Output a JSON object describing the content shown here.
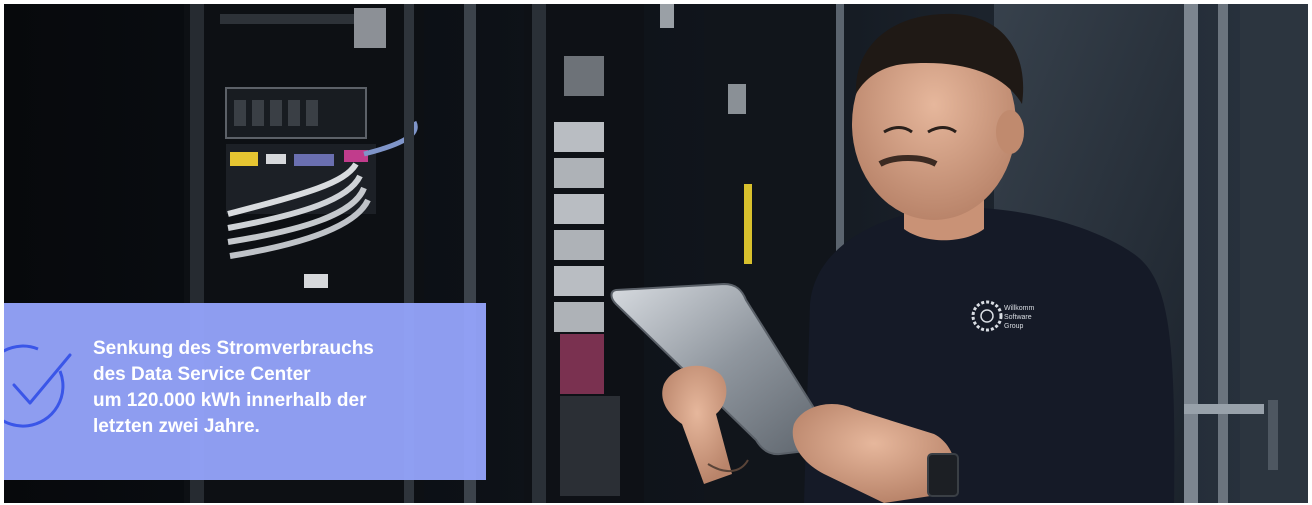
{
  "callout": {
    "lines": [
      "Senkung des Stromverbrauchs",
      "des Data Service Center",
      "um 120.000 kWh innerhalb der",
      "letzten zwei Jahre."
    ],
    "icon": "checkmark-circle-icon",
    "background": "#94A3FA",
    "accent": "#3A56E8"
  },
  "shirt_logo": {
    "lines": [
      "Willkomm",
      "Software",
      "Group"
    ]
  }
}
